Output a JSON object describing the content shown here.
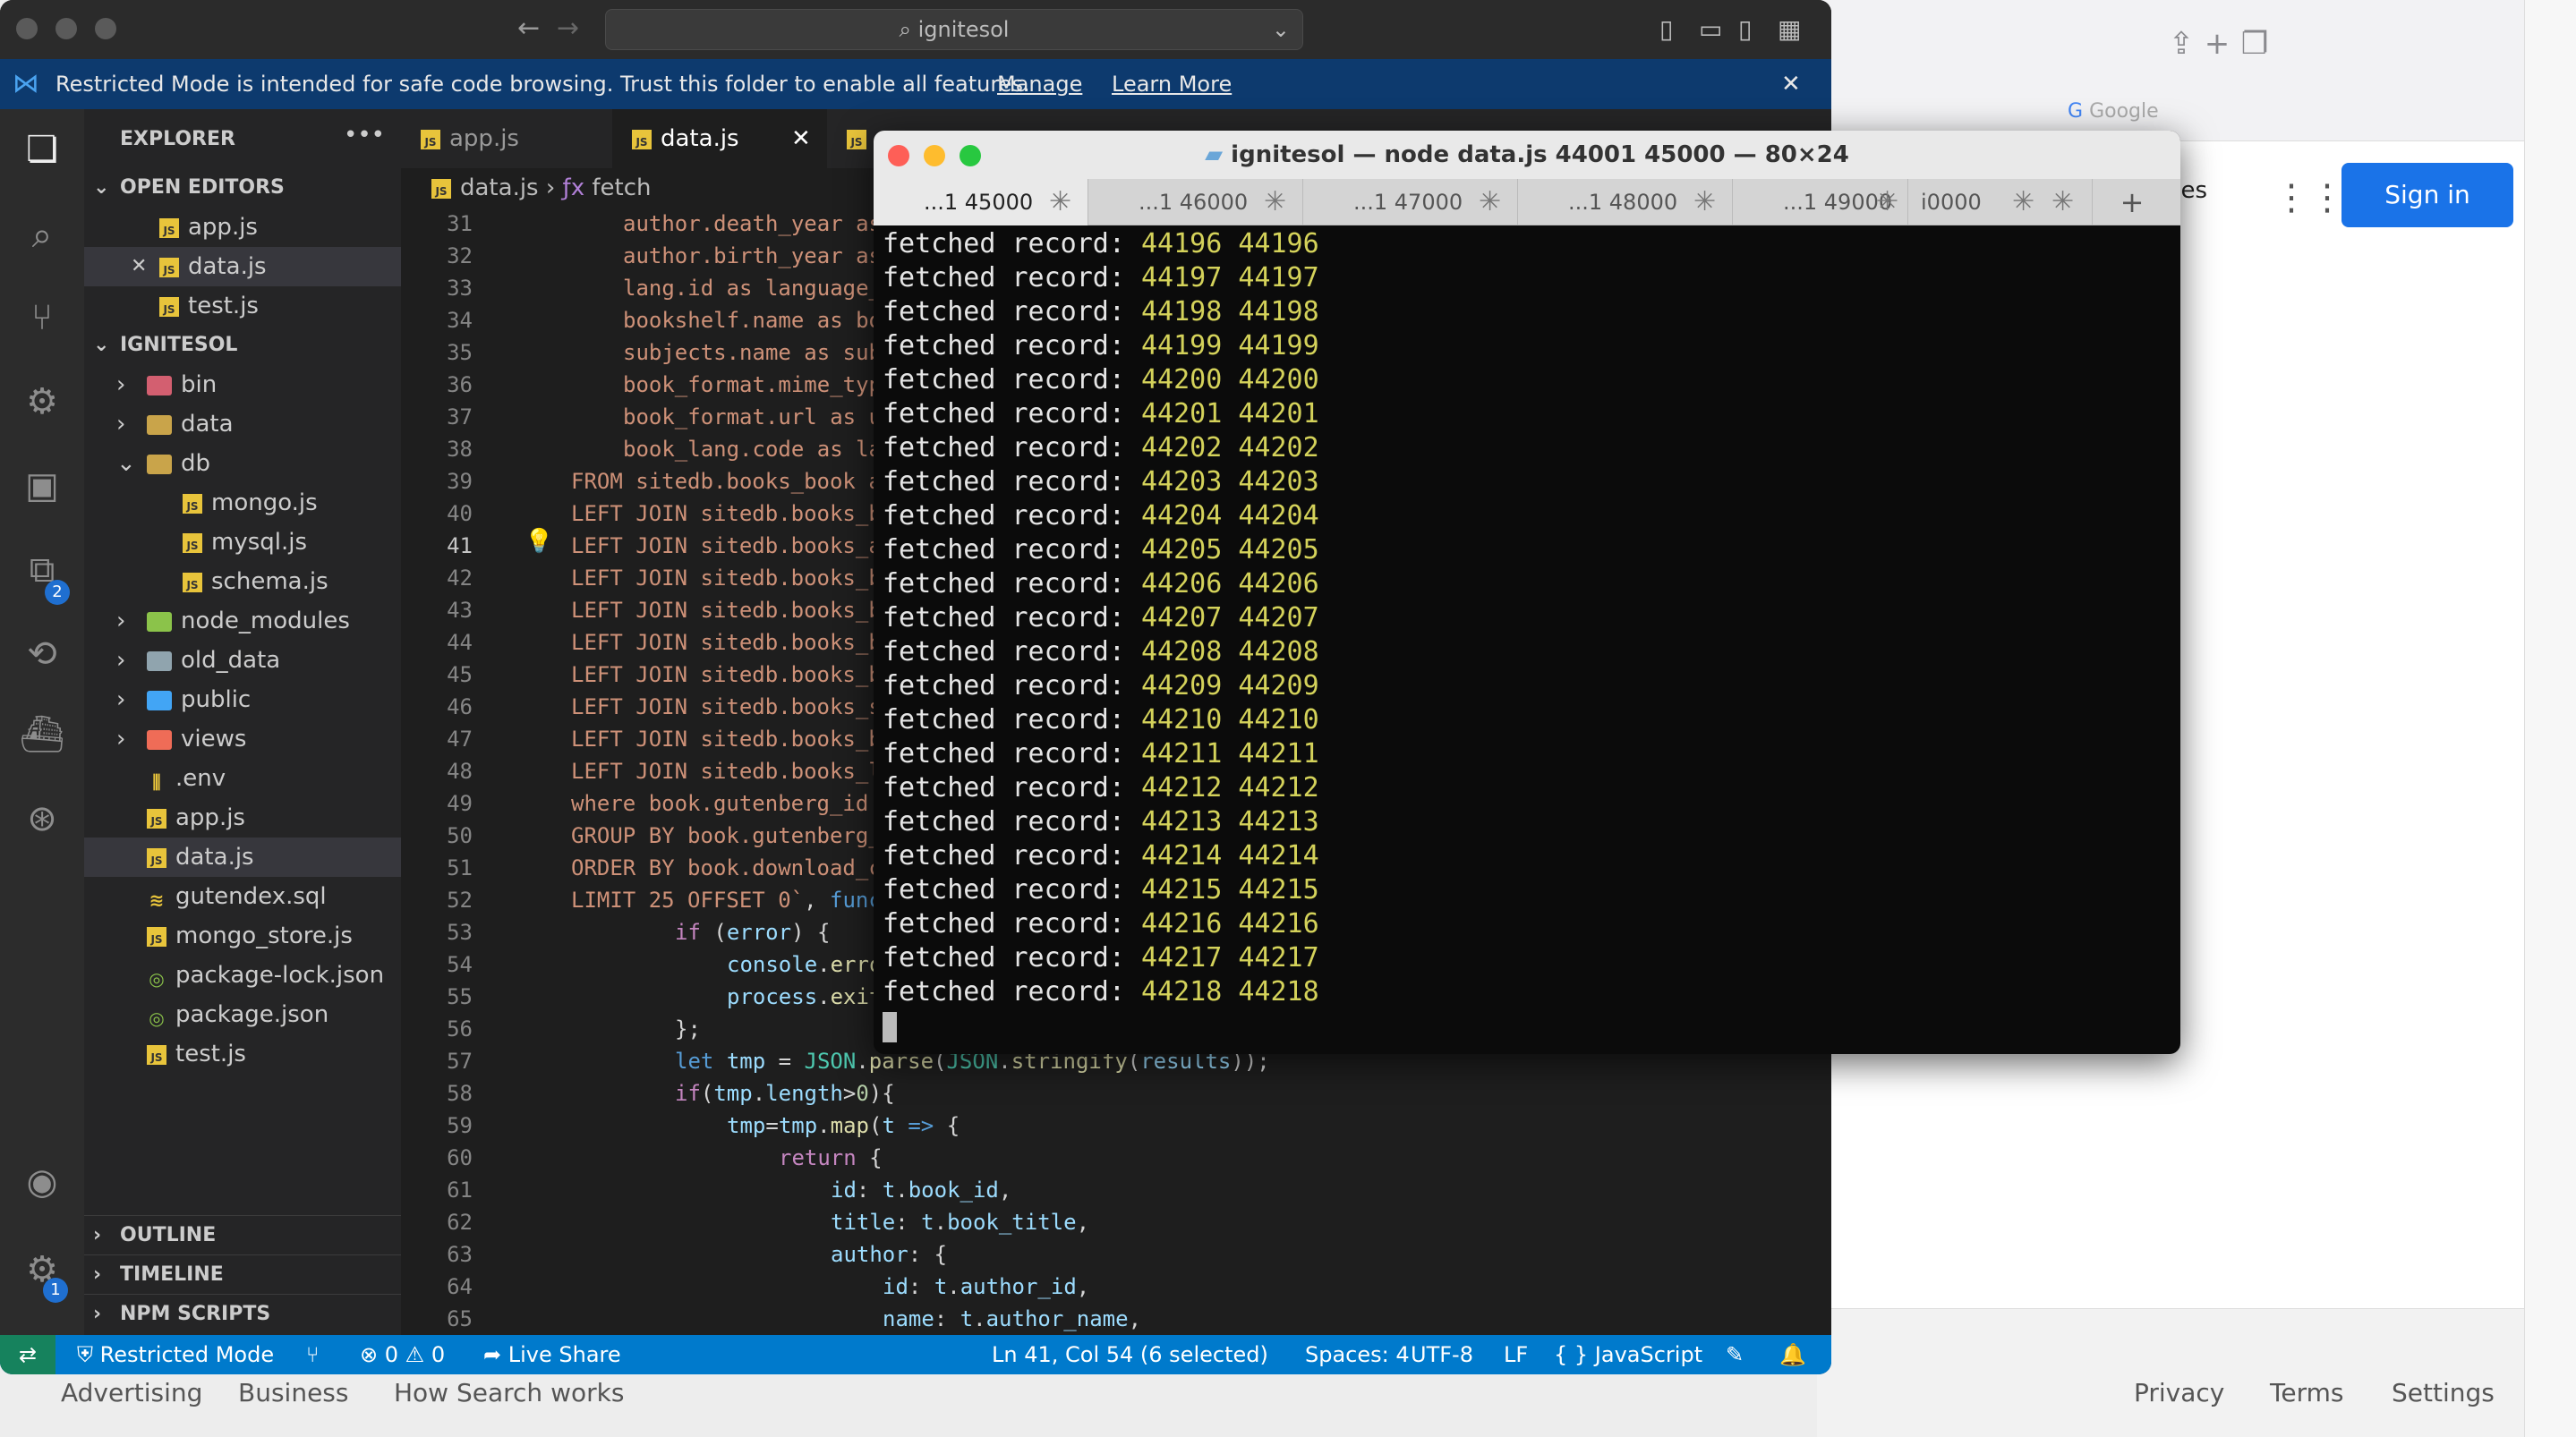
{
  "browser": {
    "google_label": "Google",
    "images_label": "ges",
    "sign_in": "Sign in",
    "footer_links": [
      "Advertising",
      "Business",
      "How Search works"
    ],
    "footer_right": [
      "Privacy",
      "Terms",
      "Settings"
    ]
  },
  "vscode": {
    "search": "ignitesol",
    "banner": {
      "text": "Restricted Mode is intended for safe code browsing. Trust this folder to enable all features.",
      "manage": "Manage",
      "learn_more": "Learn More"
    },
    "activity_badges": {
      "extensions": "2",
      "settings": "1"
    },
    "explorer_title": "EXPLORER",
    "open_editors_title": "OPEN EDITORS",
    "open_editors": [
      "app.js",
      "data.js",
      "test.js"
    ],
    "project_title": "IGNITESOL",
    "tree": [
      "bin",
      "data",
      "db",
      "mongo.js",
      "mysql.js",
      "schema.js",
      "node_modules",
      "old_data",
      "public",
      "views",
      ".env",
      "app.js",
      "data.js",
      "gutendex.sql",
      "mongo_store.js",
      "package-lock.json",
      "package.json",
      "test.js"
    ],
    "outline": "OUTLINE",
    "timeline": "TIMELINE",
    "npm_scripts": "NPM SCRIPTS",
    "tabs": [
      "app.js",
      "data.js"
    ],
    "breadcrumb": {
      "file": "data.js",
      "symbol": "fetch"
    },
    "line_numbers": [
      "31",
      "32",
      "33",
      "34",
      "35",
      "36",
      "37",
      "38",
      "39",
      "40",
      "41",
      "42",
      "43",
      "44",
      "45",
      "46",
      "47",
      "48",
      "49",
      "50",
      "51",
      "52",
      "53",
      "54",
      "55",
      "56",
      "57",
      "58",
      "59",
      "60",
      "61",
      "62",
      "63",
      "64",
      "65"
    ],
    "status": {
      "mode": "Restricted Mode",
      "errors": "0",
      "warnings": "0",
      "live_share": "Live Share",
      "position": "Ln 41, Col 54 (6 selected)",
      "spaces": "Spaces: 4",
      "encoding": "UTF-8",
      "eol": "LF",
      "language": "JavaScript"
    }
  },
  "terminal": {
    "title": "ignitesol — node data.js 44001 45000 — 80×24",
    "tabs": [
      "...1 45000",
      "...1 46000",
      "...1 47000",
      "...1 48000",
      "...1 49000",
      "i0000"
    ],
    "prefix": "fetched record:",
    "records": [
      "44196",
      "44197",
      "44198",
      "44199",
      "44200",
      "44201",
      "44202",
      "44203",
      "44204",
      "44205",
      "44206",
      "44207",
      "44208",
      "44209",
      "44210",
      "44211",
      "44212",
      "44213",
      "44214",
      "44215",
      "44216",
      "44217",
      "44218"
    ]
  }
}
